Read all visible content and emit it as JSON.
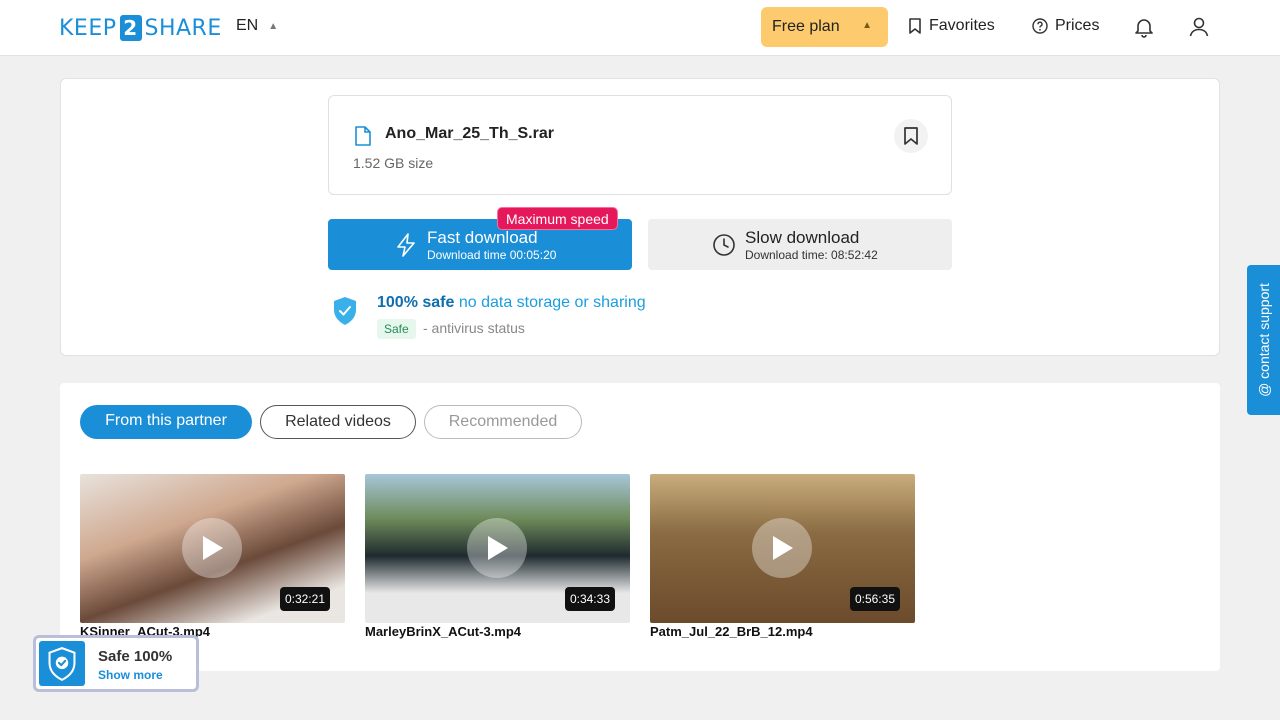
{
  "header": {
    "logo_left": "KEEP",
    "logo_num": "2",
    "logo_right": "SHARE",
    "lang": "EN",
    "plan_label": "Free plan",
    "favorites_label": "Favorites",
    "prices_label": "Prices"
  },
  "file": {
    "name": "Ano_Mar_25_Th_S.rar",
    "size": "1.52 GB size"
  },
  "download": {
    "fast_title": "Fast download",
    "fast_sub": "Download time 00:05:20",
    "badge": "Maximum speed",
    "slow_title": "Slow download",
    "slow_sub": "Download time: 08:52:42"
  },
  "safety": {
    "strong": "100% safe",
    "light": "no data storage or sharing",
    "tag": "Safe",
    "status": "- antivirus status"
  },
  "tabs": {
    "partner": "From this partner",
    "related": "Related videos",
    "recommended": "Recommended"
  },
  "videos": [
    {
      "title": "KSinner_ACut-3.mp4",
      "duration": "0:32:21"
    },
    {
      "title": "MarleyBrinX_ACut-3.mp4",
      "duration": "0:34:33"
    },
    {
      "title": "Patm_Jul_22_BrB_12.mp4",
      "duration": "0:56:35"
    }
  ],
  "contact_label": "@ contact support",
  "widget": {
    "title": "Safe 100%",
    "more": "Show more"
  },
  "colors": {
    "accent": "#1a8fd8",
    "plan": "#fdcb6e",
    "badge": "#e4185a"
  }
}
